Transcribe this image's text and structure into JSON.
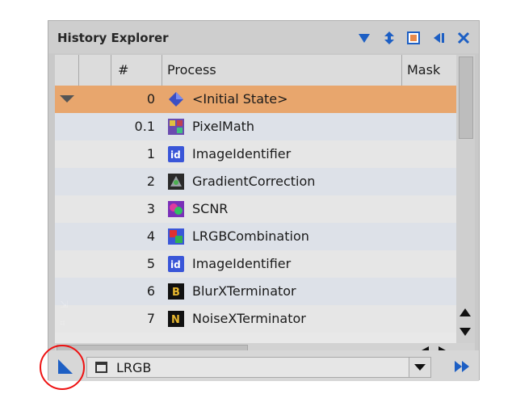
{
  "window": {
    "title": "History Explorer"
  },
  "toolbar": {
    "icons": [
      "triangle-down-icon",
      "up-down-arrows-icon",
      "box-icon",
      "step-back-icon",
      "close-icon"
    ],
    "accent": "#1d5fc4"
  },
  "table": {
    "columns": [
      "#",
      "Process",
      "Mask"
    ],
    "rows": [
      {
        "num": "0",
        "process": "<Initial State>",
        "icon": "initial-state-icon",
        "selected": true
      },
      {
        "num": "0.1",
        "process": "PixelMath",
        "icon": "pixelmath-icon"
      },
      {
        "num": "1",
        "process": "ImageIdentifier",
        "icon": "imageidentifier-icon"
      },
      {
        "num": "2",
        "process": "GradientCorrection",
        "icon": "gradientcorrection-icon"
      },
      {
        "num": "3",
        "process": "SCNR",
        "icon": "scnr-icon"
      },
      {
        "num": "4",
        "process": "LRGBCombination",
        "icon": "lrgbcombination-icon"
      },
      {
        "num": "5",
        "process": "ImageIdentifier",
        "icon": "imageidentifier-icon"
      },
      {
        "num": "6",
        "process": "BlurXTerminator",
        "icon": "blurxterminator-icon"
      },
      {
        "num": "7",
        "process": "NoiseXTerminator",
        "icon": "noisexterminator-icon"
      }
    ],
    "selection_color": "#e8a66d"
  },
  "footer": {
    "combo_value": "LRGB"
  },
  "highlight": {
    "color": "#ee1111"
  }
}
